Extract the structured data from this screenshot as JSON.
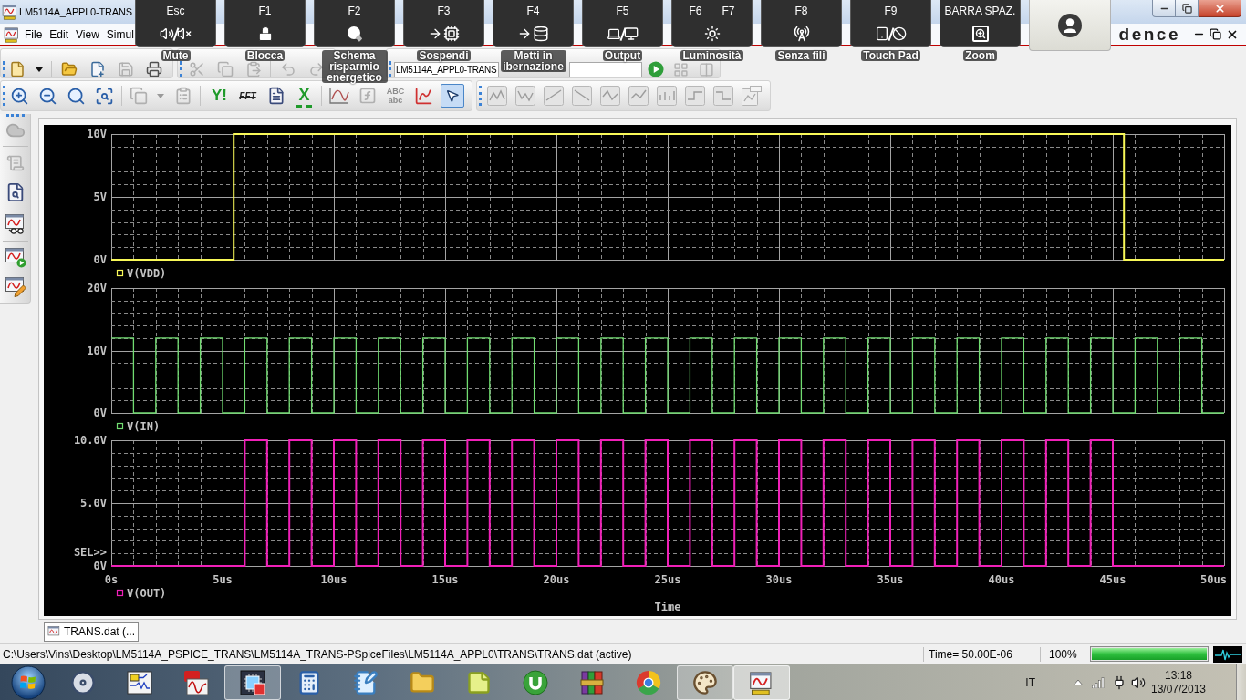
{
  "window": {
    "title": "LM5114A_APPL0-TRANS"
  },
  "menu": {
    "items": [
      "File",
      "Edit",
      "View",
      "Simul"
    ],
    "logo": "dence"
  },
  "toolbar": {
    "profile_combo": "LM5114A_APPL0-TRANS",
    "text_buttons": [
      "Y!",
      "FFT",
      "X"
    ],
    "text_case_button": [
      "ABC",
      "abc"
    ],
    "pointer_tool": {
      "selected": true
    }
  },
  "hotkey_overlay": {
    "keys": [
      {
        "keys": [
          "Esc"
        ],
        "label": "Mute"
      },
      {
        "keys": [
          "F1"
        ],
        "label": "Blocca"
      },
      {
        "keys": [
          "F2"
        ],
        "label": "Schema risparmio energetico"
      },
      {
        "keys": [
          "F3"
        ],
        "label": "Sospendi"
      },
      {
        "keys": [
          "F4"
        ],
        "label": "Metti in ibernazione"
      },
      {
        "keys": [
          "F5"
        ],
        "label": "Output"
      },
      {
        "keys": [
          "F6",
          "F7"
        ],
        "label": "Luminosità"
      },
      {
        "keys": [
          "F8"
        ],
        "label": "Senza fili"
      },
      {
        "keys": [
          "F9"
        ],
        "label": "Touch Pad"
      },
      {
        "keys": [
          "BARRA SPAZ."
        ],
        "label": "Zoom"
      }
    ]
  },
  "plots": [
    {
      "chart_data": {
        "type": "line",
        "grid": true,
        "x": [
          0,
          5.5,
          5.5,
          45.5,
          45.5,
          50
        ],
        "series": [
          {
            "name": "V(VDD)",
            "color": "#f8f858",
            "values": [
              0,
              0,
              10,
              10,
              0,
              0
            ]
          }
        ],
        "xlim": [
          0,
          50
        ],
        "ylim": [
          0,
          10
        ],
        "yticks": [
          {
            "value": 0,
            "label": "0V"
          },
          {
            "value": 5,
            "label": "5V"
          },
          {
            "value": 10,
            "label": "10V"
          }
        ]
      }
    },
    {
      "chart_data": {
        "type": "line",
        "grid": true,
        "x": [
          0,
          1,
          1,
          2,
          2,
          3,
          3,
          4,
          4,
          5,
          5,
          6,
          6,
          7,
          7,
          8,
          8,
          9,
          9,
          10,
          10,
          11,
          11,
          12,
          12,
          13,
          13,
          14,
          14,
          15,
          15,
          16,
          16,
          17,
          17,
          18,
          18,
          19,
          19,
          20,
          20,
          21,
          21,
          22,
          22,
          23,
          23,
          24,
          24,
          25,
          25,
          26,
          26,
          27,
          27,
          28,
          28,
          29,
          29,
          30,
          30,
          31,
          31,
          32,
          32,
          33,
          33,
          34,
          34,
          35,
          35,
          36,
          36,
          37,
          37,
          38,
          38,
          39,
          39,
          40,
          40,
          41,
          41,
          42,
          42,
          43,
          43,
          44,
          44,
          45,
          45,
          46,
          46,
          47,
          47,
          48,
          48,
          49,
          49,
          50
        ],
        "series": [
          {
            "name": "V(IN)",
            "color": "#70dc70",
            "values": [
              12,
              12,
              0,
              0,
              12,
              12,
              0,
              0,
              12,
              12,
              0,
              0,
              12,
              12,
              0,
              0,
              12,
              12,
              0,
              0,
              12,
              12,
              0,
              0,
              12,
              12,
              0,
              0,
              12,
              12,
              0,
              0,
              12,
              12,
              0,
              0,
              12,
              12,
              0,
              0,
              12,
              12,
              0,
              0,
              12,
              12,
              0,
              0,
              12,
              12,
              0,
              0,
              12,
              12,
              0,
              0,
              12,
              12,
              0,
              0,
              12,
              12,
              0,
              0,
              12,
              12,
              0,
              0,
              12,
              12,
              0,
              0,
              12,
              12,
              0,
              0,
              12,
              12,
              0,
              0,
              12,
              12,
              0,
              0,
              12,
              12,
              0,
              0,
              12,
              12,
              0,
              0,
              12,
              12,
              0,
              0,
              12,
              12,
              0,
              0
            ]
          }
        ],
        "xlim": [
          0,
          50
        ],
        "ylim": [
          0,
          20
        ],
        "yticks": [
          {
            "value": 0,
            "label": "0V"
          },
          {
            "value": 10,
            "label": "10V"
          },
          {
            "value": 20,
            "label": "20V"
          }
        ]
      }
    },
    {
      "selection_marker": "SEL>>",
      "chart_data": {
        "type": "line",
        "grid": true,
        "xlabel": "Time",
        "x": [
          0,
          6,
          6,
          7,
          7,
          8,
          8,
          9,
          9,
          10,
          10,
          11,
          11,
          12,
          12,
          13,
          13,
          14,
          14,
          15,
          15,
          16,
          16,
          17,
          17,
          18,
          18,
          19,
          19,
          20,
          20,
          21,
          21,
          22,
          22,
          23,
          23,
          24,
          24,
          25,
          25,
          26,
          26,
          27,
          27,
          28,
          28,
          29,
          29,
          30,
          30,
          31,
          31,
          32,
          32,
          33,
          33,
          34,
          34,
          35,
          35,
          36,
          36,
          37,
          37,
          38,
          38,
          39,
          39,
          40,
          40,
          41,
          41,
          42,
          42,
          43,
          43,
          44,
          44,
          45,
          45,
          50
        ],
        "series": [
          {
            "name": "V(OUT)",
            "color": "#f020b8",
            "values": [
              0,
              0,
              10,
              10,
              0,
              0,
              10,
              10,
              0,
              0,
              10,
              10,
              0,
              0,
              10,
              10,
              0,
              0,
              10,
              10,
              0,
              0,
              10,
              10,
              0,
              0,
              10,
              10,
              0,
              0,
              10,
              10,
              0,
              0,
              10,
              10,
              0,
              0,
              10,
              10,
              0,
              0,
              10,
              10,
              0,
              0,
              10,
              10,
              0,
              0,
              10,
              10,
              0,
              0,
              10,
              10,
              0,
              0,
              10,
              10,
              0,
              0,
              10,
              10,
              0,
              0,
              10,
              10,
              0,
              0,
              10,
              10,
              0,
              0,
              10,
              10,
              0,
              0,
              10,
              10,
              0,
              0
            ]
          }
        ],
        "xlim": [
          0,
          50
        ],
        "ylim": [
          0,
          10
        ],
        "xticks": [
          {
            "value": 0,
            "label": "0s"
          },
          {
            "value": 5,
            "label": "5us"
          },
          {
            "value": 10,
            "label": "10us"
          },
          {
            "value": 15,
            "label": "15us"
          },
          {
            "value": 20,
            "label": "20us"
          },
          {
            "value": 25,
            "label": "25us"
          },
          {
            "value": 30,
            "label": "30us"
          },
          {
            "value": 35,
            "label": "35us"
          },
          {
            "value": 40,
            "label": "40us"
          },
          {
            "value": 45,
            "label": "45us"
          },
          {
            "value": 50,
            "label": "50us"
          }
        ],
        "yticks": [
          {
            "value": 0,
            "label": "0V"
          },
          {
            "value": 5,
            "label": "5.0V"
          },
          {
            "value": 10,
            "label": "10.0V"
          }
        ]
      }
    }
  ],
  "tabs": [
    {
      "label": "TRANS.dat (..."
    }
  ],
  "status_bar": {
    "path": "C:\\Users\\Vins\\Desktop\\LM5114A_PSPICE_TRANS\\LM5114A_TRANS-PSpiceFiles\\LM5114A_APPL0\\TRANS\\TRANS.dat (active)",
    "time": "Time= 50.00E-06",
    "zoom": "100%",
    "progress": {
      "level": 1
    }
  },
  "taskbar": {
    "apps": [
      {
        "running": false,
        "selected": false
      },
      {
        "running": false,
        "selected": false
      },
      {
        "running": false,
        "selected": false
      },
      {
        "running": true,
        "selected": false
      },
      {
        "running": false,
        "selected": false
      },
      {
        "running": false,
        "selected": false
      },
      {
        "running": false,
        "selected": false
      },
      {
        "running": false,
        "selected": false
      },
      {
        "running": false,
        "selected": false
      },
      {
        "running": false,
        "selected": false
      },
      {
        "running": false,
        "selected": false
      },
      {
        "running": true,
        "selected": false
      },
      {
        "running": true,
        "selected": true
      }
    ],
    "language": "IT",
    "time": "13:18",
    "date": "13/07/2013"
  }
}
